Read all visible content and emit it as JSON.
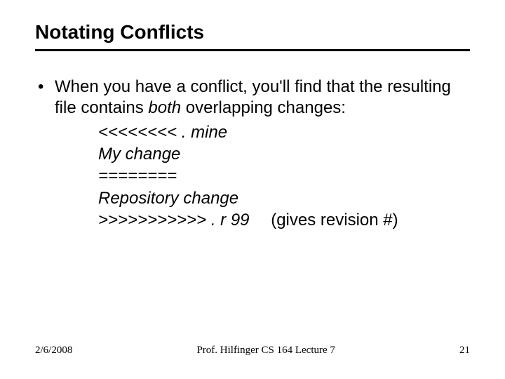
{
  "title": "Notating Conflicts",
  "bullet": {
    "pre": "When you have a conflict, you'll find that the resulting file contains ",
    "em": "both",
    "post": " overlapping changes:"
  },
  "code": {
    "l1": "<<<<<<<< . mine",
    "l2": "My change",
    "l3": "========",
    "l4": "Repository change",
    "l5": ">>>>>>>>>>> . r 99",
    "note": "(gives revision #)"
  },
  "footer": {
    "date": "2/6/2008",
    "center": "Prof. Hilfinger CS 164 Lecture 7",
    "page": "21"
  }
}
